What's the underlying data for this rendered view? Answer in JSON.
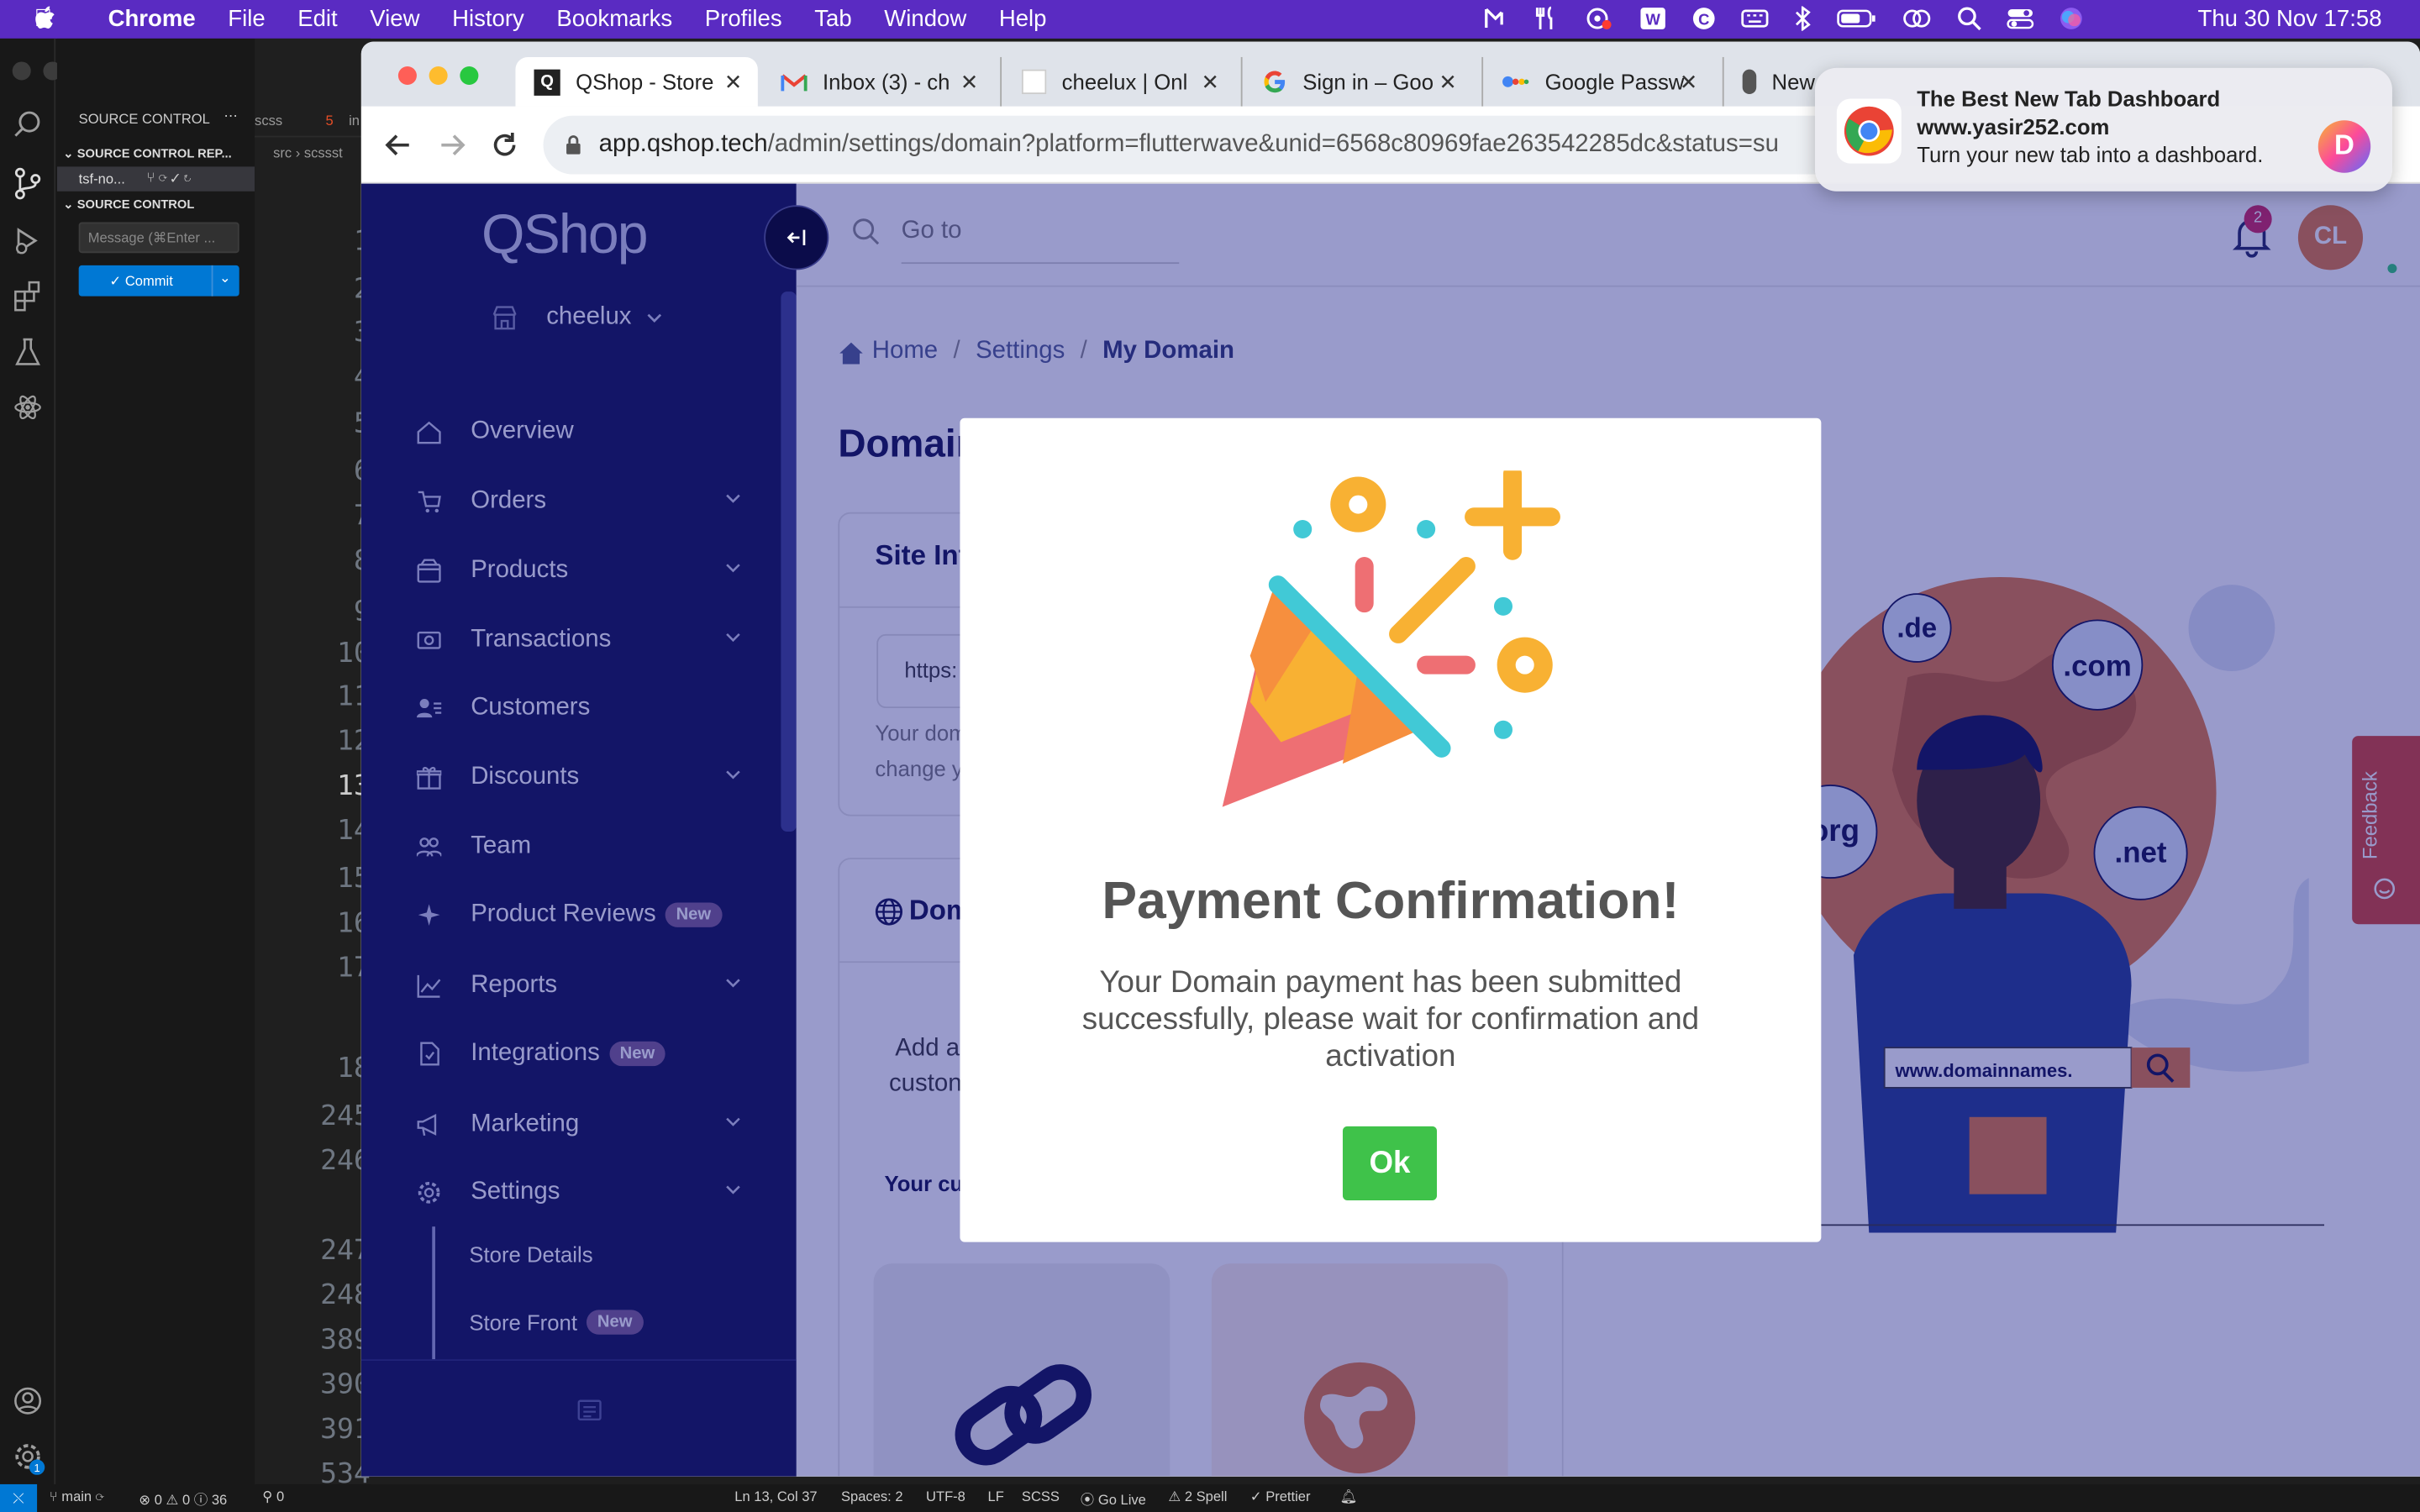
{
  "menubar": {
    "app": "Chrome",
    "items": [
      "File",
      "Edit",
      "View",
      "History",
      "Bookmarks",
      "Profiles",
      "Tab",
      "Window",
      "Help"
    ],
    "clock": "Thu 30 Nov  17:58"
  },
  "vscode": {
    "panel_title": "SOURCE CONTROL",
    "repos_header": "SOURCE CONTROL REP...",
    "repo_name": "tsf-no...",
    "section_header": "SOURCE CONTROL",
    "message_placeholder": "Message (⌘Enter ...",
    "commit_label": "✓ Commit",
    "editor_tabs": [
      "scss",
      "in"
    ],
    "breadcrumb": "src › scssst",
    "line_numbers": [
      "1",
      "2",
      "3",
      "4",
      "5",
      "6",
      "7",
      "8",
      "9",
      "10",
      "11",
      "12",
      "13",
      "14",
      "15",
      "16",
      "17",
      "18",
      "245",
      "246",
      "247",
      "248",
      "389",
      "390",
      "391",
      "534"
    ],
    "status": {
      "branch": "main",
      "problems": "⊗ 0 ⚠ 0 ⓘ 36",
      "ports": "⚲ 0",
      "position": "Ln 13, Col 37",
      "spaces": "Spaces: 2",
      "encoding": "UTF-8",
      "eol": "LF",
      "language": "SCSS",
      "golive": "Go Live",
      "spell": "2 Spell",
      "prettier": "✓ Prettier"
    }
  },
  "chrome": {
    "tabs": [
      {
        "title": "QShop - Store",
        "active": true
      },
      {
        "title": "Inbox (3) - ch"
      },
      {
        "title": "cheelux | Onl"
      },
      {
        "title": "Sign in – Goo"
      },
      {
        "title": "Google Passw"
      },
      {
        "title": "New"
      }
    ],
    "url_host": "app.qshop.tech",
    "url_path": "/admin/settings/domain?platform=flutterwave&unid=6568c80969fae263542285dc&status=su"
  },
  "notification": {
    "title": "The Best New Tab Dashboard",
    "subtitle": "www.yasir252.com",
    "body": "Turn your new tab into a dashboard.",
    "badge_letter": "D"
  },
  "qshop": {
    "logo": "QShop",
    "store_name": "cheelux",
    "search_placeholder": "Go to",
    "notification_count": "2",
    "avatar_initials": "CL",
    "nav": [
      {
        "label": "Overview",
        "icon": "home-icon"
      },
      {
        "label": "Orders",
        "icon": "cart-icon",
        "chevron": true
      },
      {
        "label": "Products",
        "icon": "box-icon",
        "chevron": true
      },
      {
        "label": "Transactions",
        "icon": "cash-icon",
        "chevron": true
      },
      {
        "label": "Customers",
        "icon": "user-list-icon"
      },
      {
        "label": "Discounts",
        "icon": "gift-icon",
        "chevron": true
      },
      {
        "label": "Team",
        "icon": "team-icon"
      },
      {
        "label": "Product Reviews",
        "icon": "sparkle-icon",
        "badge": "New"
      },
      {
        "label": "Reports",
        "icon": "chart-icon",
        "chevron": true
      },
      {
        "label": "Integrations",
        "icon": "plugin-icon",
        "badge": "New"
      },
      {
        "label": "Marketing",
        "icon": "megaphone-icon",
        "chevron": true
      },
      {
        "label": "Settings",
        "icon": "gear-icon",
        "chevron": true
      }
    ],
    "subnav": [
      {
        "label": "Store Details"
      },
      {
        "label": "Store Front",
        "badge": "New"
      }
    ],
    "breadcrumb": {
      "home": "Home",
      "settings": "Settings",
      "current": "My Domain"
    },
    "page_title": "Domain",
    "site_info_title": "Site Info",
    "site_url_value": "https:",
    "site_help_1": "Your dom",
    "site_help_2": "change y",
    "domain_section_title": "Dom",
    "add_text_1": "Add a",
    "add_text_2": "custon",
    "your_custom": "Your cu",
    "illustration_tlds": [
      ".de",
      ".com",
      ".org",
      ".net"
    ],
    "illustration_search": "www.domainnames.",
    "feedback_label": "Feedback"
  },
  "modal": {
    "title": "Payment Confirmation!",
    "message": "Your Domain payment has been submitted successfully, please wait for confirmation and activation",
    "ok_label": "Ok"
  }
}
